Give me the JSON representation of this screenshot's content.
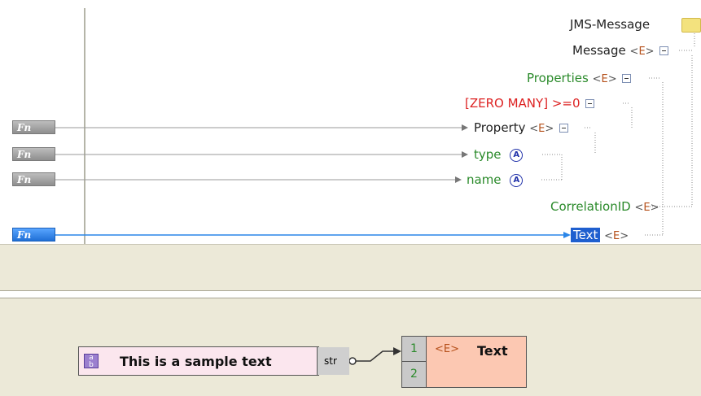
{
  "mapping_tree": {
    "root": {
      "label": "JMS-Message",
      "icon": "folder-icon"
    },
    "nodes": [
      {
        "key": "message",
        "label": "Message",
        "tag": "E",
        "color": "#222222"
      },
      {
        "key": "properties",
        "label": "Properties",
        "tag": "E",
        "color": "#2a8a2a"
      },
      {
        "key": "zero_many",
        "label": "[ZERO MANY]",
        "suffix": ">=0",
        "color": "#dd2222"
      },
      {
        "key": "property",
        "label": "Property",
        "tag": "E",
        "color": "#222222"
      },
      {
        "key": "type",
        "label": "type",
        "tag": "A",
        "color": "#2a8a2a"
      },
      {
        "key": "name",
        "label": "name",
        "tag": "A",
        "color": "#2a8a2a"
      },
      {
        "key": "correlation",
        "label": "CorrelationID",
        "tag": "E",
        "color": "#2a8a2a"
      },
      {
        "key": "text",
        "label": "Text",
        "tag": "E",
        "color": "#ffffff",
        "selected": true
      }
    ],
    "fn_buttons": [
      {
        "label": "Fn",
        "active": false
      },
      {
        "label": "Fn",
        "active": false
      },
      {
        "label": "Fn",
        "active": false
      },
      {
        "label": "Fn",
        "active": true
      }
    ],
    "text": {
      "root": "JMS-Message",
      "message": "Message",
      "properties": "Properties",
      "zero_many": "[ZERO MANY]",
      "zero_many_suffix": ">=0",
      "property": "Property",
      "type": "type",
      "name": "name",
      "correlation": "CorrelationID",
      "text": "Text",
      "fn": "Fn",
      "e_tag": "E",
      "a_tag": "A"
    }
  },
  "function_designer": {
    "constant": {
      "value": "This is a sample text",
      "port_label": "str",
      "icon": "constant-icon"
    },
    "target": {
      "label": "Text",
      "tag": "E",
      "port1": "1",
      "port2": "2"
    }
  },
  "colors": {
    "selection": "#1f5fcf",
    "active_line": "#2a86e8",
    "inactive_line": "#9a9a9a",
    "panel_bg": "#ece9d8"
  }
}
